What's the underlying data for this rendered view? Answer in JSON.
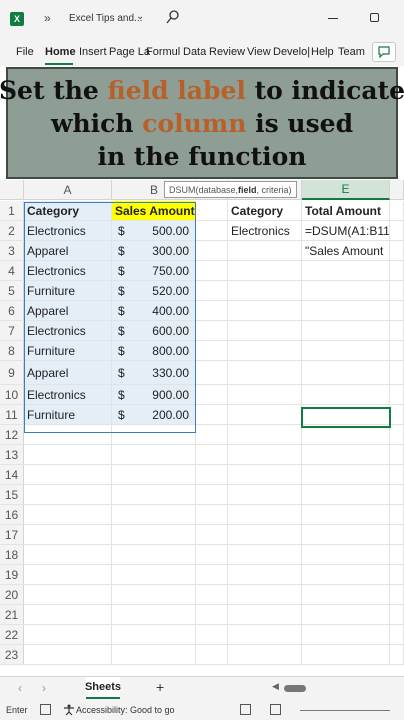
{
  "titlebar": {
    "more": "»",
    "title": "Excel Tips and...",
    "chevron": "⌄"
  },
  "ribbon": {
    "tabs": [
      "File",
      "Home",
      "Insert",
      "Page La",
      "Formul",
      "Data",
      "Review",
      "View",
      "Develo|",
      "Help",
      "Team"
    ],
    "active": "Home"
  },
  "banner": {
    "line1_a": "Set the ",
    "line1_hl": "field label",
    "line1_b": " to indicate",
    "line2_a": "which ",
    "line2_hl": "column",
    "line2_b": " is used",
    "line3": "in the function",
    "highlight_color": "#b8602a"
  },
  "grid": {
    "columns": [
      "A",
      "B",
      "E"
    ],
    "tooltip": {
      "prefix": "DSUM(database, ",
      "bold": "field",
      "suffix": ", criteria)"
    },
    "header_row": {
      "a": "Category",
      "b": "Sales Amount",
      "d": "Category",
      "e": "Total Amount"
    },
    "rows": [
      {
        "n": "2",
        "category": "Electronics",
        "currency": "$",
        "amount": "500.00"
      },
      {
        "n": "3",
        "category": "Apparel",
        "currency": "$",
        "amount": "300.00"
      },
      {
        "n": "4",
        "category": "Electronics",
        "currency": "$",
        "amount": "750.00"
      },
      {
        "n": "5",
        "category": "Furniture",
        "currency": "$",
        "amount": "520.00"
      },
      {
        "n": "6",
        "category": "Apparel",
        "currency": "$",
        "amount": "400.00"
      },
      {
        "n": "7",
        "category": "Electronics",
        "currency": "$",
        "amount": "600.00"
      },
      {
        "n": "8",
        "category": "Furniture",
        "currency": "$",
        "amount": "800.00"
      },
      {
        "n": "9",
        "category": "Apparel",
        "currency": "$",
        "amount": "330.00"
      },
      {
        "n": "10",
        "category": "Electronics",
        "currency": "$",
        "amount": "900.00"
      },
      {
        "n": "11",
        "category": "Furniture",
        "currency": "$",
        "amount": "200.00"
      }
    ],
    "criteria_value": "Electronics",
    "formula_line1": "=DSUM(A1:B11,",
    "formula_line2": "\"Sales Amount",
    "empty_rows": [
      "12",
      "13",
      "14",
      "15",
      "16",
      "17",
      "18",
      "19",
      "20",
      "21",
      "22",
      "23"
    ],
    "header_highlight": "#ffff00"
  },
  "sheetbar": {
    "prev": "‹",
    "next": "›",
    "sheet": "Sheets",
    "add": "+"
  },
  "statusbar": {
    "mode": "Enter",
    "accessibility": "Accessibility: Good to go"
  }
}
